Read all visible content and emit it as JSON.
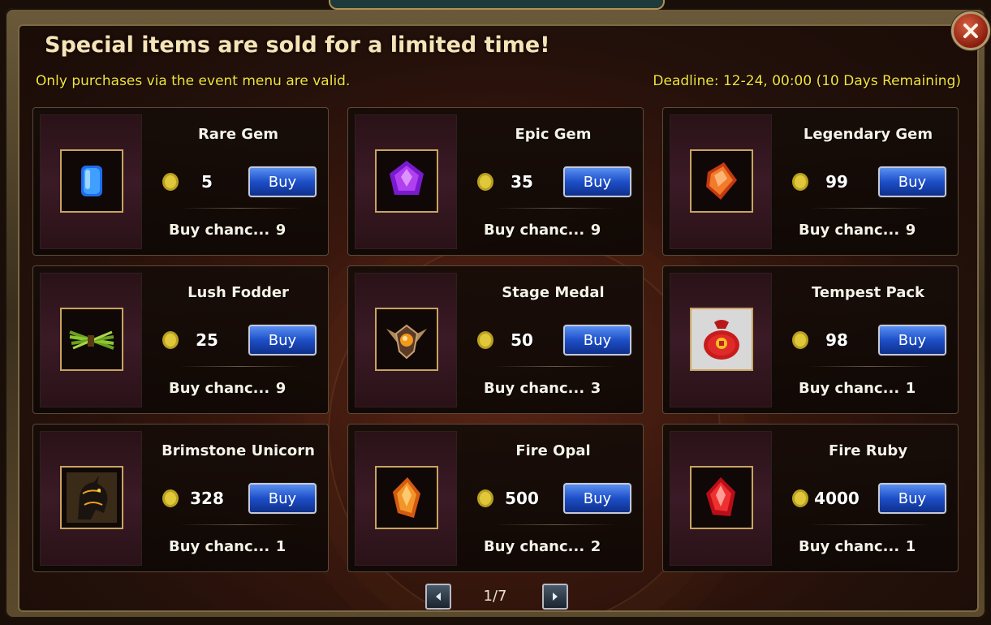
{
  "header": {
    "title": "Special items are sold for a limited time!",
    "note": "Only purchases via the event menu are valid.",
    "deadline": "Deadline: 12-24, 00:00 (10 Days Remaining)"
  },
  "items": [
    {
      "name": "Rare Gem",
      "price": "5",
      "buy_label": "Buy",
      "chance_label": "Buy chanc...",
      "chance": "9",
      "icon": "blue-gem-icon"
    },
    {
      "name": "Epic Gem",
      "price": "35",
      "buy_label": "Buy",
      "chance_label": "Buy chanc...",
      "chance": "9",
      "icon": "purple-gem-icon"
    },
    {
      "name": "Legendary Gem",
      "price": "99",
      "buy_label": "Buy",
      "chance_label": "Buy chanc...",
      "chance": "9",
      "icon": "orange-gem-icon"
    },
    {
      "name": "Lush Fodder",
      "price": "25",
      "buy_label": "Buy",
      "chance_label": "Buy chanc...",
      "chance": "9",
      "icon": "fodder-icon"
    },
    {
      "name": "Stage Medal",
      "price": "50",
      "buy_label": "Buy",
      "chance_label": "Buy chanc...",
      "chance": "3",
      "icon": "medal-icon"
    },
    {
      "name": "Tempest Pack",
      "price": "98",
      "buy_label": "Buy",
      "chance_label": "Buy chanc...",
      "chance": "1",
      "icon": "red-bag-icon"
    },
    {
      "name": "Brimstone Unicorn",
      "price": "328",
      "buy_label": "Buy",
      "chance_label": "Buy chanc...",
      "chance": "1",
      "icon": "unicorn-icon"
    },
    {
      "name": "Fire Opal",
      "price": "500",
      "buy_label": "Buy",
      "chance_label": "Buy chanc...",
      "chance": "2",
      "icon": "fire-opal-icon"
    },
    {
      "name": "Fire Ruby",
      "price": "4000",
      "buy_label": "Buy",
      "chance_label": "Buy chanc...",
      "chance": "1",
      "icon": "fire-ruby-icon"
    }
  ],
  "pager": {
    "page": "1/7"
  },
  "colors": {
    "accent_text": "#f5e33c",
    "button_blue": "#1d4fc8",
    "frame_gold": "#c9a460"
  }
}
